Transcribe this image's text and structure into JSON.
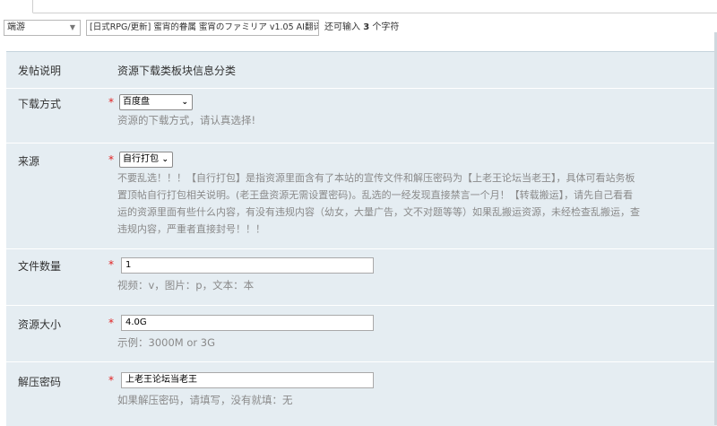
{
  "header": {
    "type_select_value": "端游",
    "title_value": "[日式RPG/更新] 蜜宵的眷属 蜜宵のファミリア v1.05 AI翻译汉化版",
    "char_hint_prefix": "还可输入",
    "char_hint_count": "3",
    "char_hint_suffix": "个字符"
  },
  "form": {
    "post_note": {
      "label": "发帖说明",
      "value": "资源下载类板块信息分类"
    },
    "download_method": {
      "label": "下载方式",
      "required": "*",
      "selected": "百度盘",
      "help": "资源的下载方式，请认真选择!"
    },
    "source": {
      "label": "来源",
      "required": "*",
      "selected": "自行打包",
      "help_lines": [
        "不要乱选！！！【自行打包】是指资源里面含有了本站的宣传文件和解压密码为【上老王论坛当老王】，具体可看站务板",
        "置顶帖自行打包相关说明。(老王盘资源无需设置密码)。乱选的一经发现直接禁言一个月！【转载搬运】，请先自己看看",
        "运的资源里面有些什么内容，有没有违规内容（幼女，大量广告，文不对题等等）如果乱搬运资源，未经检查乱搬运，查",
        "违规内容，严重者直接封号！！！"
      ]
    },
    "file_count": {
      "label": "文件数量",
      "required": "*",
      "value": "1",
      "help": "视频：v，图片：p，文本：本"
    },
    "resource_size": {
      "label": "资源大小",
      "required": "*",
      "value": "4.0G",
      "help": "示例：3000M or 3G"
    },
    "unzip_password": {
      "label": "解压密码",
      "required": "*",
      "value": "上老王论坛当老王",
      "help": "如果解压密码，请填写，没有就填：无"
    }
  },
  "colors": {
    "panel_bg": "#e5edf2",
    "required": "#e02020",
    "help_text": "#8a8a8a"
  }
}
